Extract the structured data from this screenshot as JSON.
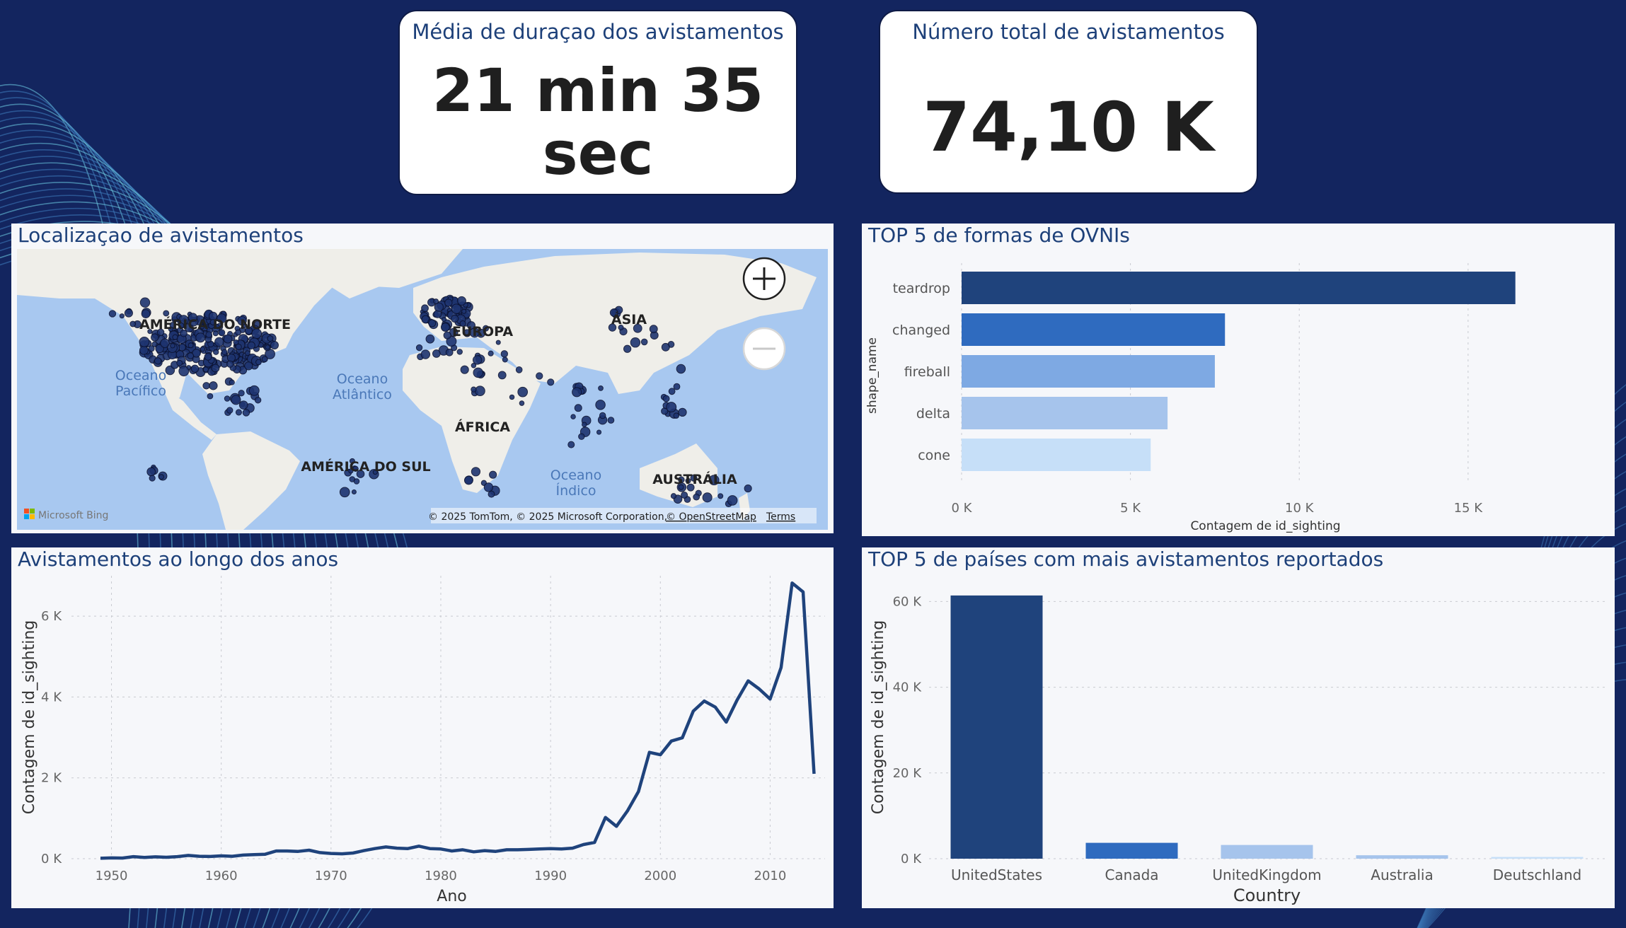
{
  "kpi_duration": {
    "title": "Média de duraçao dos avistamentos",
    "value_line1": "21 min 35",
    "value_line2": "sec"
  },
  "kpi_total": {
    "title": "Número total de avistamentos",
    "value": "74,10 K"
  },
  "map": {
    "title": "Localizaçao de avistamentos",
    "zoom_in_icon": "plus-icon",
    "zoom_out_icon": "minus-icon",
    "labels": {
      "north_america": "AMÉRICA DO NORTE",
      "europe": "EUROPA",
      "asia": "ÁSIA",
      "africa": "ÁFRICA",
      "south_america": "AMÉRICA DO SUL",
      "australia": "AUSTRÁLIA",
      "pacific_1": "Oceano",
      "pacific_2": "Pacífico",
      "atlantic_1": "Oceano",
      "atlantic_2": "Atlântico",
      "indian_1": "Oceano",
      "indian_2": "Índico"
    },
    "bing_logo": "Microsoft Bing",
    "copyright": "© 2025 TomTom, © 2025 Microsoft Corporation,",
    "osm_link": "© OpenStreetMap",
    "terms_link": "Terms"
  },
  "shapes": {
    "title": "TOP 5 de formas de OVNIs"
  },
  "years": {
    "title": "Avistamentos ao longo dos anos"
  },
  "countries": {
    "title": "TOP 5 de países com mais avistamentos reportados"
  },
  "chart_data": [
    {
      "type": "bar",
      "orientation": "horizontal",
      "title": "TOP 5 de formas de OVNIs",
      "categories": [
        "teardrop",
        "changed",
        "fireball",
        "delta",
        "cone"
      ],
      "values": [
        16400,
        7800,
        7500,
        6100,
        5600
      ],
      "colors": [
        "#1f437c",
        "#2f6bbf",
        "#7ea9e3",
        "#a6c4ec",
        "#c6dff8"
      ],
      "xlabel": "Contagem de id_sighting",
      "ylabel": "shape_name",
      "xlim": [
        0,
        18000
      ],
      "x_ticks": [
        "0 K",
        "5 K",
        "10 K",
        "15 K"
      ],
      "grid": true
    },
    {
      "type": "line",
      "title": "Avistamentos ao longo dos anos",
      "xlabel": "Ano",
      "ylabel": "Contagem de id_sighting",
      "x": [
        1949,
        1950,
        1951,
        1952,
        1953,
        1954,
        1955,
        1956,
        1957,
        1958,
        1959,
        1960,
        1961,
        1962,
        1963,
        1964,
        1965,
        1966,
        1967,
        1968,
        1969,
        1970,
        1971,
        1972,
        1973,
        1974,
        1975,
        1976,
        1977,
        1978,
        1979,
        1980,
        1981,
        1982,
        1983,
        1984,
        1985,
        1986,
        1987,
        1988,
        1989,
        1990,
        1991,
        1992,
        1993,
        1994,
        1995,
        1996,
        1997,
        1998,
        1999,
        2000,
        2001,
        2002,
        2003,
        2004,
        2005,
        2006,
        2007,
        2008,
        2009,
        2010,
        2011,
        2012,
        2013,
        2014
      ],
      "y": [
        10,
        20,
        15,
        50,
        30,
        45,
        35,
        50,
        80,
        60,
        55,
        70,
        60,
        90,
        100,
        110,
        190,
        190,
        180,
        210,
        150,
        130,
        120,
        140,
        200,
        250,
        290,
        260,
        250,
        310,
        250,
        240,
        190,
        220,
        170,
        200,
        180,
        220,
        220,
        230,
        240,
        250,
        240,
        260,
        350,
        400,
        1020,
        800,
        1180,
        1660,
        2630,
        2570,
        2910,
        2990,
        3650,
        3900,
        3750,
        3380,
        3930,
        4400,
        4200,
        3950,
        4730,
        6820,
        6600,
        2100
      ],
      "xlim": [
        1947,
        2015
      ],
      "ylim": [
        0,
        7000
      ],
      "x_ticks": [
        "1950",
        "1960",
        "1970",
        "1980",
        "1990",
        "2000",
        "2010"
      ],
      "y_ticks": [
        "0 K",
        "2 K",
        "4 K",
        "6 K"
      ],
      "color": "#1f437c",
      "grid": true
    },
    {
      "type": "bar",
      "title": "TOP 5 de países com mais avistamentos reportados",
      "categories": [
        "UnitedStates",
        "Canada",
        "UnitedKingdom",
        "Australia",
        "Deutschland"
      ],
      "values": [
        61400,
        3700,
        3200,
        800,
        400
      ],
      "colors": [
        "#1f437c",
        "#2f6bbf",
        "#a6c4ec",
        "#a6c4ec",
        "#c6dff8"
      ],
      "xlabel": "Country",
      "ylabel": "Contagem de id_sighting",
      "ylim": [
        0,
        66000
      ],
      "y_ticks": [
        "0 K",
        "20 K",
        "40 K",
        "60 K"
      ],
      "grid": true
    }
  ]
}
